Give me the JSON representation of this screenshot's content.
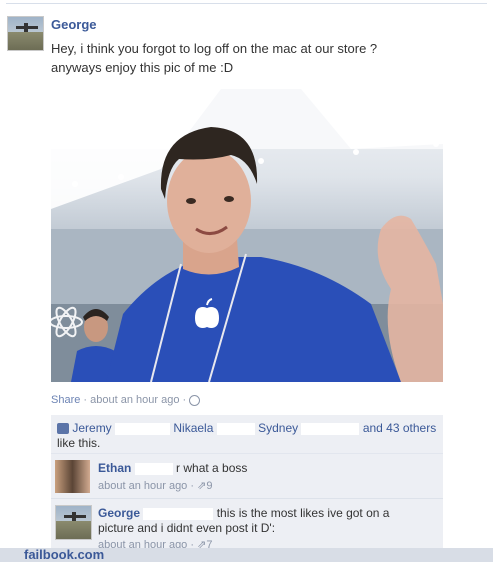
{
  "post": {
    "author": "George",
    "message_line1": "Hey, i think you forgot to log off on the mac at our store ?",
    "message_line2": "anyways enjoy this pic of me :D",
    "meta_share": "Share",
    "meta_time": "about an hour ago",
    "sep": "·"
  },
  "likes": {
    "name1": "Jeremy",
    "name2": "Nikaela",
    "name3": "Sydney",
    "others": "and 43 others",
    "suffix": "like this."
  },
  "comments": [
    {
      "author": "Ethan",
      "text": "r what a boss",
      "time": "about an hour ago",
      "likes": "9"
    },
    {
      "author": "George",
      "text_line1": "this is the most likes ive got on a",
      "text_line2": "picture and i didnt even post it D':",
      "time": "about an hour ago",
      "likes": "7"
    }
  ],
  "watermark": "failbook.com",
  "colors": {
    "link": "#3b5998",
    "meta": "#8b95a8",
    "panel": "#edeff4",
    "shirt": "#2a4fb8"
  }
}
